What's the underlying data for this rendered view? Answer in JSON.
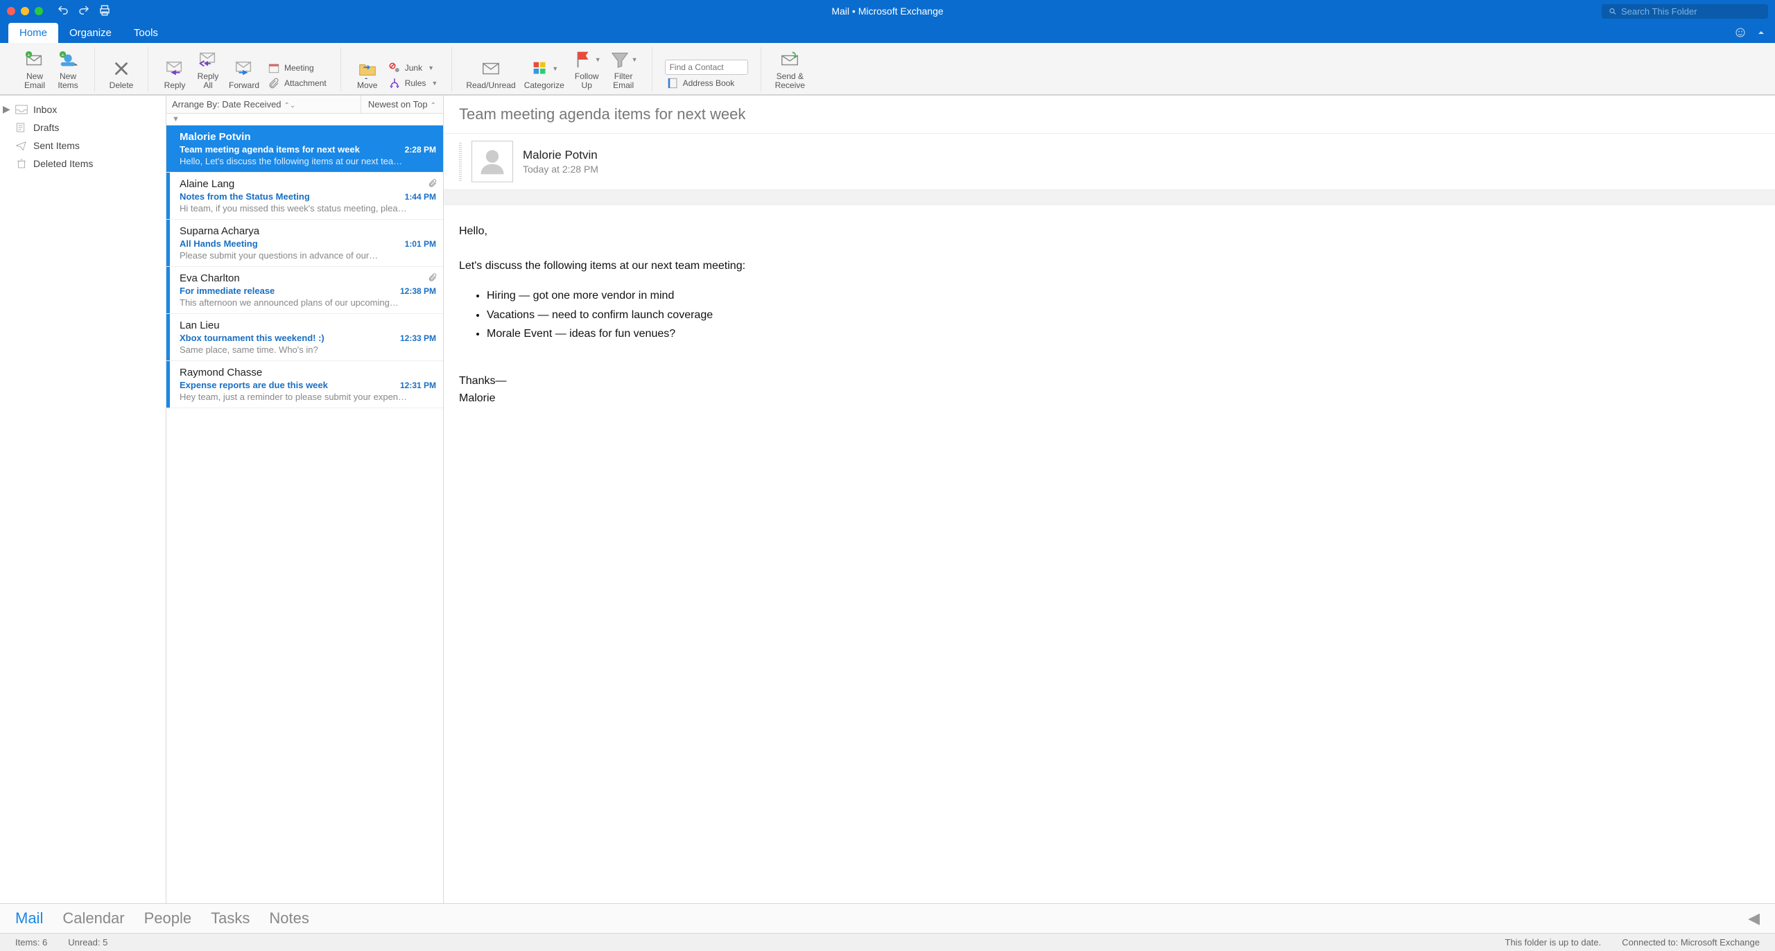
{
  "title": "Mail • Microsoft Exchange",
  "search_placeholder": "Search This Folder",
  "tabs": {
    "home": "Home",
    "organize": "Organize",
    "tools": "Tools"
  },
  "ribbon": {
    "new_email": "New\nEmail",
    "new_items": "New\nItems",
    "delete": "Delete",
    "reply": "Reply",
    "reply_all": "Reply\nAll",
    "forward": "Forward",
    "meeting": "Meeting",
    "attachment": "Attachment",
    "move": "Move",
    "junk": "Junk",
    "rules": "Rules",
    "read_unread": "Read/Unread",
    "categorize": "Categorize",
    "follow_up": "Follow\nUp",
    "filter_email": "Filter\nEmail",
    "find_contact_placeholder": "Find a Contact",
    "address_book": "Address Book",
    "send_receive": "Send &\nReceive"
  },
  "folders": {
    "inbox": "Inbox",
    "drafts": "Drafts",
    "sent": "Sent Items",
    "deleted": "Deleted Items"
  },
  "list_header": {
    "arrange": "Arrange By: Date Received",
    "sort": "Newest on Top"
  },
  "messages": [
    {
      "from": "Malorie Potvin",
      "subject": "Team meeting agenda items for next week",
      "time": "2:28 PM",
      "preview": "Hello, Let's discuss the following items at our next tea…",
      "attach": false,
      "selected": true,
      "unread": true
    },
    {
      "from": "Alaine Lang",
      "subject": "Notes from the Status Meeting",
      "time": "1:44 PM",
      "preview": "Hi team, if you missed this week's status meeting, plea…",
      "attach": true,
      "selected": false,
      "unread": true
    },
    {
      "from": "Suparna Acharya",
      "subject": "All Hands Meeting",
      "time": "1:01 PM",
      "preview": "Please submit your questions in advance of our…",
      "attach": false,
      "selected": false,
      "unread": true
    },
    {
      "from": "Eva Charlton",
      "subject": "For immediate release",
      "time": "12:38 PM",
      "preview": "This afternoon we announced plans of our upcoming…",
      "attach": true,
      "selected": false,
      "unread": true
    },
    {
      "from": "Lan Lieu",
      "subject": "Xbox tournament this weekend!  :)",
      "time": "12:33 PM",
      "preview": "Same place, same time. Who's in?",
      "attach": false,
      "selected": false,
      "unread": true
    },
    {
      "from": "Raymond Chasse",
      "subject": "Expense reports are due this week",
      "time": "12:31 PM",
      "preview": "Hey team, just a reminder to please submit your expen…",
      "attach": false,
      "selected": false,
      "unread": true
    }
  ],
  "reading": {
    "subject": "Team meeting agenda items for next week",
    "from": "Malorie Potvin",
    "date": "Today at 2:28 PM",
    "greeting": "Hello,",
    "intro": "Let's discuss the following items at our next team meeting:",
    "bullets": [
      "Hiring — got one more vendor in mind",
      "Vacations — need to confirm launch coverage",
      "Morale Event — ideas for fun venues?"
    ],
    "closing1": "Thanks—",
    "closing2": "Malorie"
  },
  "switcher": {
    "mail": "Mail",
    "calendar": "Calendar",
    "people": "People",
    "tasks": "Tasks",
    "notes": "Notes"
  },
  "status": {
    "items": "Items: 6",
    "unread": "Unread: 5",
    "sync": "This folder is up to date.",
    "conn": "Connected to: Microsoft Exchange"
  }
}
